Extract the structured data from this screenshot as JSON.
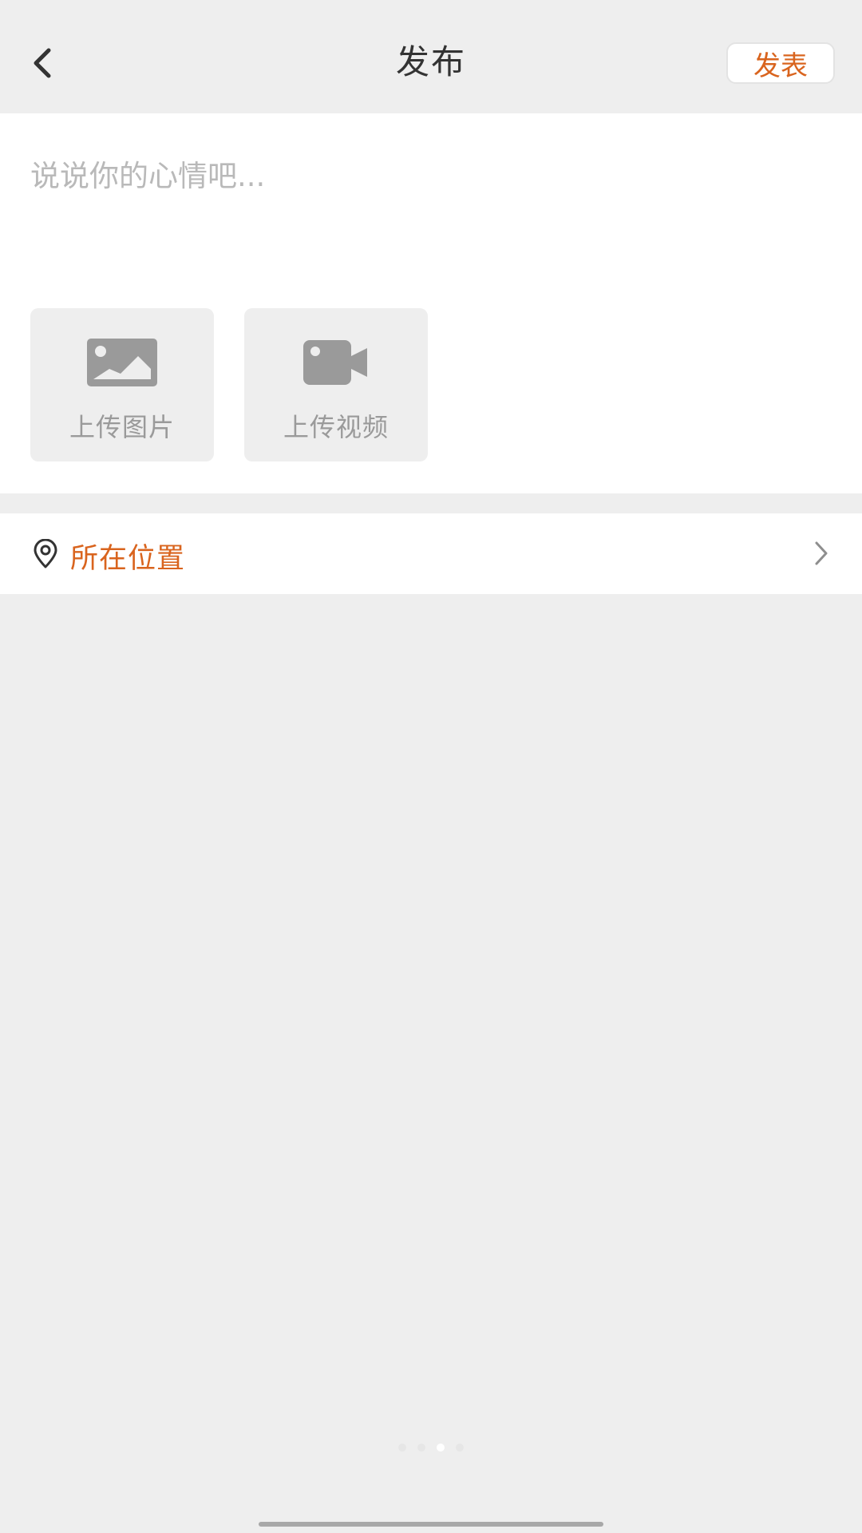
{
  "header": {
    "title": "发布",
    "publish_label": "发表"
  },
  "composer": {
    "placeholder": "说说你的心情吧...",
    "value": ""
  },
  "upload": {
    "image_label": "上传图片",
    "video_label": "上传视频",
    "image_icon": "image-icon",
    "video_icon": "video-camera-icon"
  },
  "location": {
    "label": "所在位置",
    "icon": "location-pin-icon"
  },
  "pager": {
    "count": 4,
    "active_index": 2
  },
  "colors": {
    "accent": "#d9641e",
    "background": "#eeeeee",
    "card": "#ffffff",
    "placeholder": "#b9b9b9",
    "icon_gray": "#9a9a9a"
  }
}
